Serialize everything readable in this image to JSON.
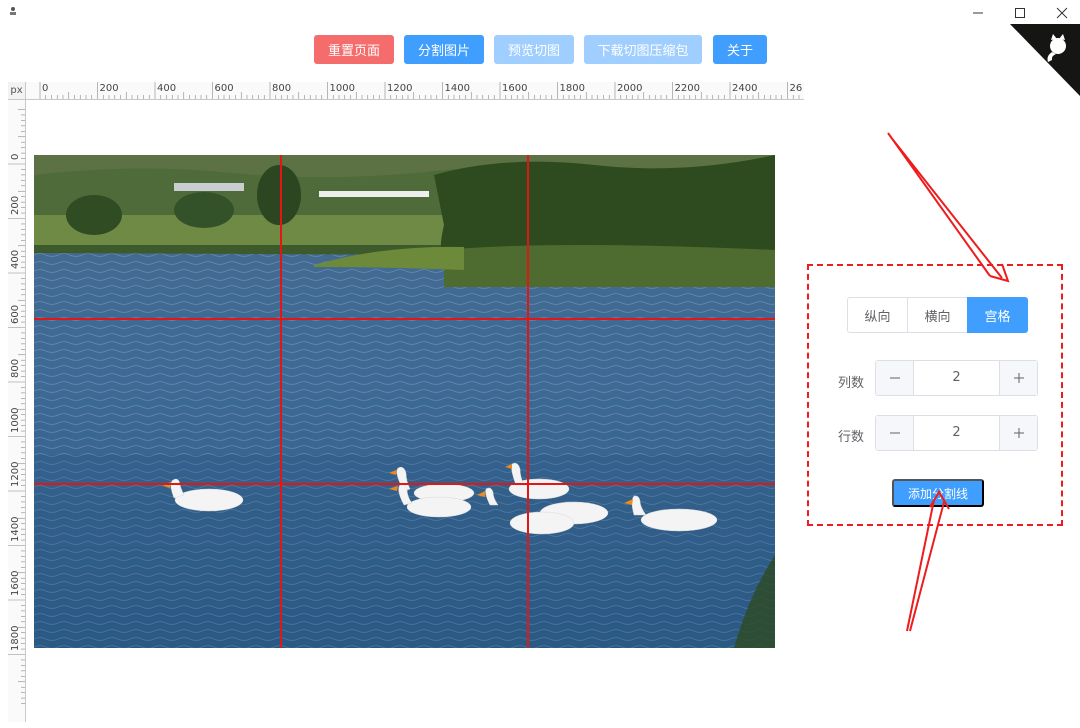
{
  "window": {
    "icon": "app-icon",
    "controls": [
      "minimize-icon",
      "maximize-icon",
      "close-icon"
    ]
  },
  "toolbar": {
    "reset_label": "重置页面",
    "split_label": "分割图片",
    "preview_label": "预览切图",
    "download_label": "下载切图压缩包",
    "about_label": "关于"
  },
  "ruler": {
    "unit": "px",
    "h_ticks": [
      "0",
      "200",
      "400",
      "600",
      "800",
      "1000",
      "1200",
      "1400",
      "1600",
      "1800",
      "2000",
      "2200",
      "2400",
      "26"
    ],
    "v_ticks": [
      "0",
      "200",
      "400",
      "600",
      "800",
      "1000",
      "1200",
      "1400",
      "1600",
      "1800"
    ]
  },
  "panel": {
    "modes": [
      "纵向",
      "横向",
      "宫格"
    ],
    "active_mode": "宫格",
    "cols_label": "列数",
    "cols_value": "2",
    "rows_label": "行数",
    "rows_value": "2",
    "add_label": "添加分割线"
  },
  "colors": {
    "primary": "#409eff",
    "danger": "#f56c6c",
    "disabled": "#a0cfff",
    "split_line": "#e31515",
    "annotation": "#ee1c1c"
  }
}
